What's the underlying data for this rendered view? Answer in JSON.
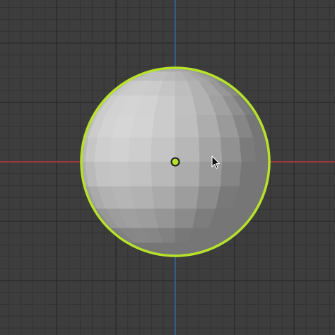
{
  "viewport": {
    "view": "front-orthographic",
    "background_color": "#3d3d3d",
    "grid": {
      "shown": true,
      "minor_line_color": "#333333",
      "major_line_color": "#2c2c2c"
    },
    "axes": {
      "x_axis_color": "#c0393e",
      "z_axis_color": "#2f6aa0"
    }
  },
  "selected_object": {
    "type": "uv-sphere",
    "selected": true,
    "active": true,
    "outline_color": "#b7e22b",
    "origin_color": "#b7e22b",
    "shading": "solid-flat"
  },
  "cursor": {
    "icon": "arrow-pointer-icon",
    "color": "#111111"
  }
}
